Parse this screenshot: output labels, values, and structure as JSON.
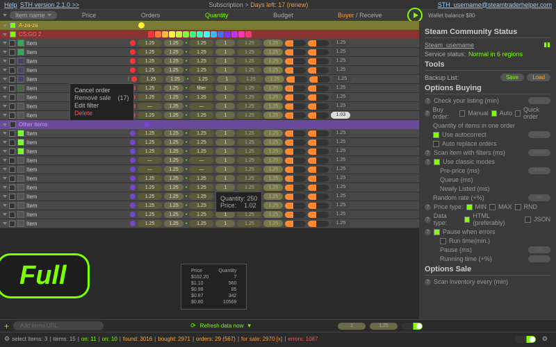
{
  "top": {
    "help": "Help",
    "version": "STH version 2.1.0 >>",
    "sub": "Subscription >",
    "days": "Days left: 17 (renew)",
    "email": "STH_username@steamtraderhelper.com"
  },
  "hdr": {
    "dd": "Item name",
    "price": "Price",
    "orders": "Orders",
    "quantity": "Quantity",
    "budget": "Budget",
    "buyer": "Buyer",
    "receive": " / Receive",
    "wallet": "Wallet balance $80"
  },
  "groups": {
    "g1": "A-za-za",
    "g2": "CS:GO 2",
    "g3": "Other items"
  },
  "item": "Item",
  "val": "1.25",
  "one": "1",
  "dash": "—",
  "filter": "filter",
  "rp": "1.03",
  "f": "f",
  "ctx1": {
    "a": "Cancel order",
    "b": "Remove sale",
    "n": "(17)",
    "c": "Edit filter",
    "d": "Delete"
  },
  "ctx2": {
    "q": "Quantity:",
    "qv": "250",
    "p": "Price:",
    "pv": "1.02"
  },
  "ctx3": {
    "h1": "Price",
    "h2": "Quantity",
    "r": [
      [
        "$102.20",
        "7"
      ],
      [
        "$1.10",
        "560"
      ],
      [
        "$0.98",
        "85"
      ],
      [
        "$0.87",
        "342"
      ],
      [
        "$0.80",
        "10569"
      ]
    ]
  },
  "badge": "Full",
  "right": {
    "scs": "Steam Community Status",
    "user": "Steam_username",
    "svc": "Service status:",
    "svcv": "Normal in 6 regions",
    "tools": "Tools",
    "bk": "Backup List:",
    "save": "Save",
    "load": "Load",
    "ob": "Options Buying",
    "chk": "Check your listing (min)",
    "bo": "Buy order:",
    "man": "Manual",
    "auto": "Auto",
    "qo": "Quick order",
    "qty": "Quantity of items in one order",
    "uac": "Use autocorrect",
    "aro": "Auto replace orders",
    "v002": "0.02",
    "scan": "Scan item with filters (ms)",
    "v10000": "10000",
    "ucm": "Use classic modes",
    "pp": "Pre-price (ms)",
    "v1000": "1000",
    "queue": "Queue (ms)",
    "nl": "Newly Listed (ms)",
    "rr": "Random rate (+%)",
    "v50": "50",
    "pt": "Price type:",
    "min": "MIN",
    "max": "MAX",
    "rnd": "RND",
    "dt": "Data type:",
    "html": "HTML (preferably)",
    "json": "JSON",
    "pwe": "Pause when errors",
    "rt": "Run time(min.)",
    "pause": "Pause (ms)",
    "rtime": "Running time (+%)",
    "v15": "15",
    "os": "Options Sale",
    "sie": "Scan inventory every (min)"
  },
  "foot": {
    "url": "Add items URL",
    "refresh": "Refresh data now",
    "p1": "1",
    "p2": "1.25",
    "sel": "select items: 3",
    "items": "items: 15",
    "on": "on: 11",
    "on2": "on: 10",
    "found": "found: 3016",
    "bought": "bought: 2971",
    "orders": "orders: 29 (567)",
    "sale": "for sale: 2970 [x]",
    "err": "errors: 1087"
  }
}
